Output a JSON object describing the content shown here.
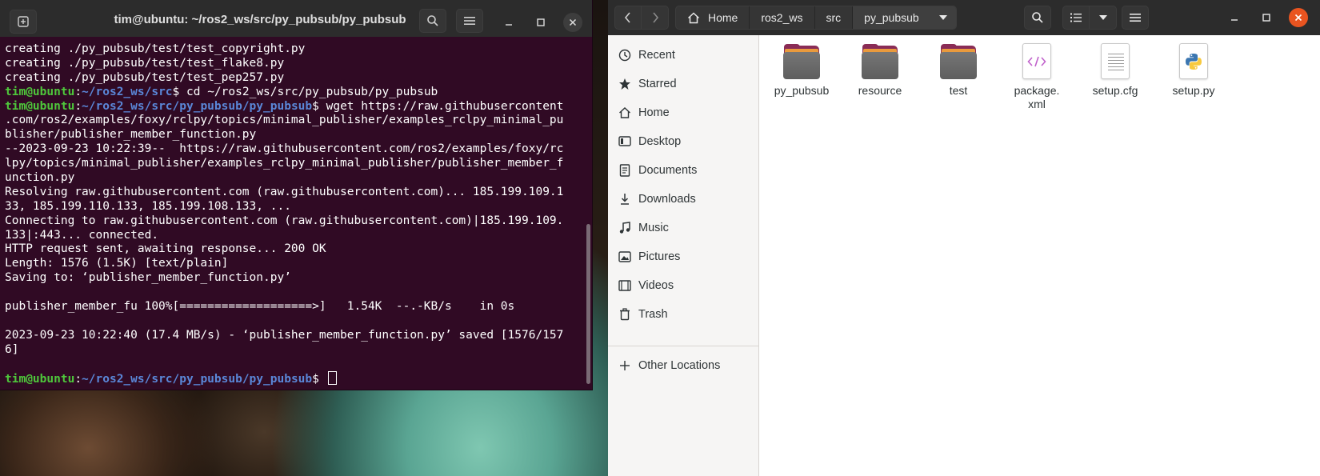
{
  "terminal": {
    "title": "tim@ubuntu: ~/ros2_ws/src/py_pubsub/py_pubsub",
    "lines": [
      {
        "type": "text",
        "text": "creating ./py_pubsub/test/test_copyright.py"
      },
      {
        "type": "text",
        "text": "creating ./py_pubsub/test/test_flake8.py"
      },
      {
        "type": "text",
        "text": "creating ./py_pubsub/test/test_pep257.py"
      },
      {
        "type": "prompt",
        "user": "tim@ubuntu",
        "sep": ":",
        "path": "~/ros2_ws/src",
        "sym": "$ ",
        "cmd": "cd ~/ros2_ws/src/py_pubsub/py_pubsub"
      },
      {
        "type": "prompt",
        "user": "tim@ubuntu",
        "sep": ":",
        "path": "~/ros2_ws/src/py_pubsub/py_pubsub",
        "sym": "$ ",
        "cmd": "wget https://raw.githubusercontent"
      },
      {
        "type": "text",
        "text": ".com/ros2/examples/foxy/rclpy/topics/minimal_publisher/examples_rclpy_minimal_pu"
      },
      {
        "type": "text",
        "text": "blisher/publisher_member_function.py"
      },
      {
        "type": "text",
        "text": "--2023-09-23 10:22:39--  https://raw.githubusercontent.com/ros2/examples/foxy/rc"
      },
      {
        "type": "text",
        "text": "lpy/topics/minimal_publisher/examples_rclpy_minimal_publisher/publisher_member_f"
      },
      {
        "type": "text",
        "text": "unction.py"
      },
      {
        "type": "text",
        "text": "Resolving raw.githubusercontent.com (raw.githubusercontent.com)... 185.199.109.1"
      },
      {
        "type": "text",
        "text": "33, 185.199.110.133, 185.199.108.133, ..."
      },
      {
        "type": "text",
        "text": "Connecting to raw.githubusercontent.com (raw.githubusercontent.com)|185.199.109."
      },
      {
        "type": "text",
        "text": "133|:443... connected."
      },
      {
        "type": "text",
        "text": "HTTP request sent, awaiting response... 200 OK"
      },
      {
        "type": "text",
        "text": "Length: 1576 (1.5K) [text/plain]"
      },
      {
        "type": "text",
        "text": "Saving to: ‘publisher_member_function.py’"
      },
      {
        "type": "text",
        "text": ""
      },
      {
        "type": "text",
        "text": "publisher_member_fu 100%[===================>]   1.54K  --.-KB/s    in 0s"
      },
      {
        "type": "text",
        "text": ""
      },
      {
        "type": "text",
        "text": "2023-09-23 10:22:40 (17.4 MB/s) - ‘publisher_member_function.py’ saved [1576/157"
      },
      {
        "type": "text",
        "text": "6]"
      },
      {
        "type": "text",
        "text": ""
      },
      {
        "type": "prompt",
        "user": "tim@ubuntu",
        "sep": ":",
        "path": "~/ros2_ws/src/py_pubsub/py_pubsub",
        "sym": "$ ",
        "cmd": "",
        "cursor": true
      }
    ]
  },
  "files": {
    "breadcrumbs": [
      "Home",
      "ros2_ws",
      "src",
      "py_pubsub"
    ],
    "sidebar": [
      {
        "label": "Recent",
        "icon": "clock-icon"
      },
      {
        "label": "Starred",
        "icon": "star-icon"
      },
      {
        "label": "Home",
        "icon": "home-icon"
      },
      {
        "label": "Desktop",
        "icon": "desktop-icon"
      },
      {
        "label": "Documents",
        "icon": "document-icon"
      },
      {
        "label": "Downloads",
        "icon": "download-icon"
      },
      {
        "label": "Music",
        "icon": "music-icon"
      },
      {
        "label": "Pictures",
        "icon": "picture-icon"
      },
      {
        "label": "Videos",
        "icon": "video-icon"
      },
      {
        "label": "Trash",
        "icon": "trash-icon"
      },
      {
        "label": "Other Locations",
        "icon": "plus-icon"
      }
    ],
    "items": [
      {
        "name": "py_pubsub",
        "kind": "folder"
      },
      {
        "name": "resource",
        "kind": "folder"
      },
      {
        "name": "test",
        "kind": "folder"
      },
      {
        "name": "package.\nxml",
        "kind": "xml"
      },
      {
        "name": "setup.cfg",
        "kind": "text"
      },
      {
        "name": "setup.py",
        "kind": "python"
      }
    ]
  },
  "colors": {
    "terminal_bg": "#300a24",
    "prompt_user": "#4ec73b",
    "prompt_path": "#5a87d8",
    "folder_accent": "#8a2c56",
    "close_button": "#e95420"
  }
}
